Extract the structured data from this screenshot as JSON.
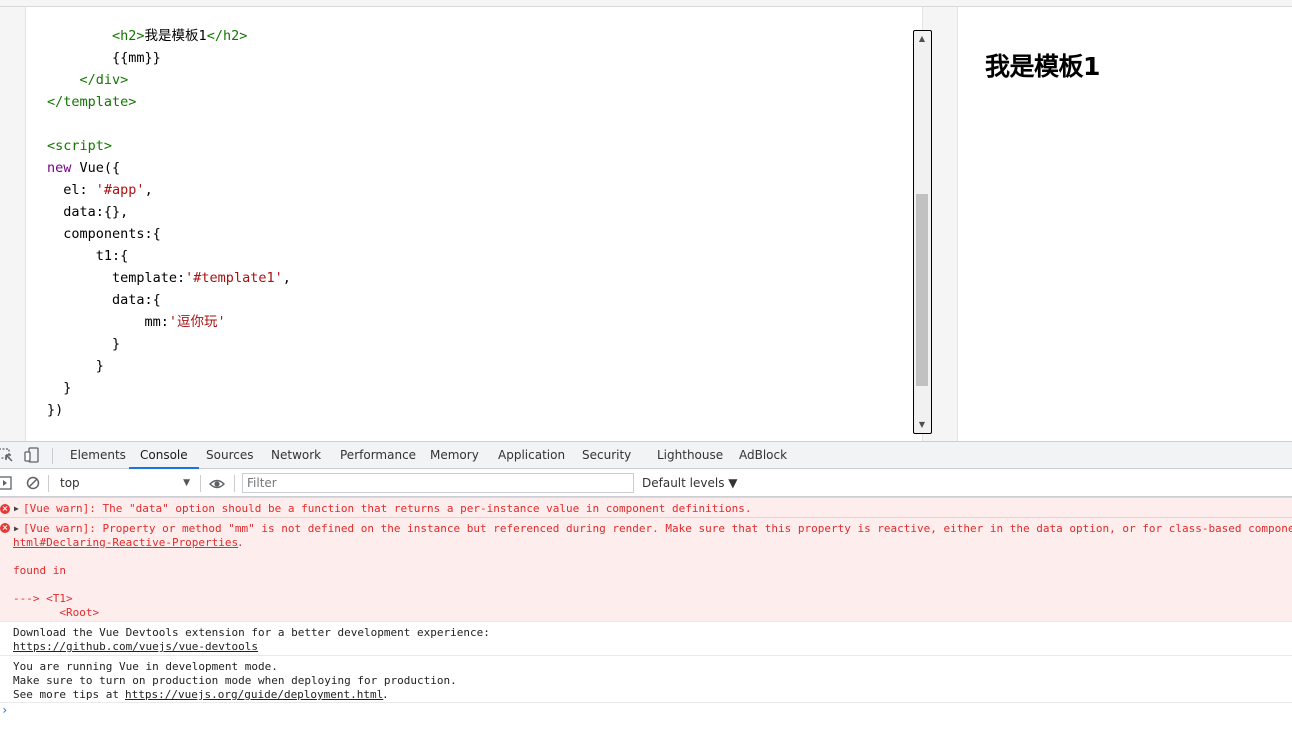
{
  "editor": {
    "lines": [
      [
        {
          "c": "tag",
          "t": "        <h2>"
        },
        {
          "c": "plain",
          "t": "我是模板1"
        },
        {
          "c": "tag",
          "t": "</h2>"
        }
      ],
      [
        {
          "c": "plain",
          "t": "        {{mm}}"
        }
      ],
      [
        {
          "c": "tag",
          "t": "    </div>"
        }
      ],
      [
        {
          "c": "tag",
          "t": "</template>"
        }
      ],
      [
        {
          "c": "plain",
          "t": ""
        }
      ],
      [
        {
          "c": "tag",
          "t": "<script>"
        }
      ],
      [
        {
          "c": "kw",
          "t": "new"
        },
        {
          "c": "plain",
          "t": " Vue({"
        }
      ],
      [
        {
          "c": "plain",
          "t": "  el: "
        },
        {
          "c": "str",
          "t": "'#app'"
        },
        {
          "c": "plain",
          "t": ","
        }
      ],
      [
        {
          "c": "plain",
          "t": "  data:{},"
        }
      ],
      [
        {
          "c": "plain",
          "t": "  components:{"
        }
      ],
      [
        {
          "c": "plain",
          "t": "      t1:{"
        }
      ],
      [
        {
          "c": "plain",
          "t": "        template:"
        },
        {
          "c": "str",
          "t": "'#template1'"
        },
        {
          "c": "plain",
          "t": ","
        }
      ],
      [
        {
          "c": "plain",
          "t": "        data:{"
        }
      ],
      [
        {
          "c": "plain",
          "t": "            mm:"
        },
        {
          "c": "str",
          "t": "'逗你玩'"
        }
      ],
      [
        {
          "c": "plain",
          "t": "        }"
        }
      ],
      [
        {
          "c": "plain",
          "t": "      }"
        }
      ],
      [
        {
          "c": "plain",
          "t": "  }"
        }
      ],
      [
        {
          "c": "plain",
          "t": "})"
        }
      ]
    ]
  },
  "preview": {
    "heading": "我是模板1"
  },
  "devtools": {
    "tabs": [
      "Elements",
      "Console",
      "Sources",
      "Network",
      "Performance",
      "Memory",
      "Application",
      "Security",
      "Lighthouse",
      "AdBlock"
    ],
    "active_tab": "Console",
    "toolbar": {
      "context": "top",
      "filter_placeholder": "Filter",
      "levels": "Default levels ▼"
    },
    "messages": {
      "err1": "[Vue warn]: The \"data\" option should be a function that returns a per-instance value in component definitions.",
      "err2_line1": "[Vue warn]: Property or method \"mm\" is not defined on the instance but referenced during render. Make sure that this property is reactive, either in the data option, or for class-based components, by initializing the property.",
      "err2_link": "html#Declaring-Reactive-Properties",
      "err2_found": "found in",
      "err2_t1": "---> <T1>",
      "err2_root": "       <Root>",
      "log1_text": "Download the Vue Devtools extension for a better development experience:",
      "log1_link": "https://github.com/vuejs/vue-devtools",
      "log2_l1": "You are running Vue in development mode.",
      "log2_l2": "Make sure to turn on production mode when deploying for production.",
      "log2_l3_prefix": "See more tips at ",
      "log2_link": "https://vuejs.org/guide/deployment.html",
      "log2_l3_suffix": "."
    }
  },
  "colors": {
    "tag": "#117700",
    "keyword": "#770088",
    "string": "#aa1111",
    "error": "#e22b2b",
    "accent": "#1a73e8"
  }
}
